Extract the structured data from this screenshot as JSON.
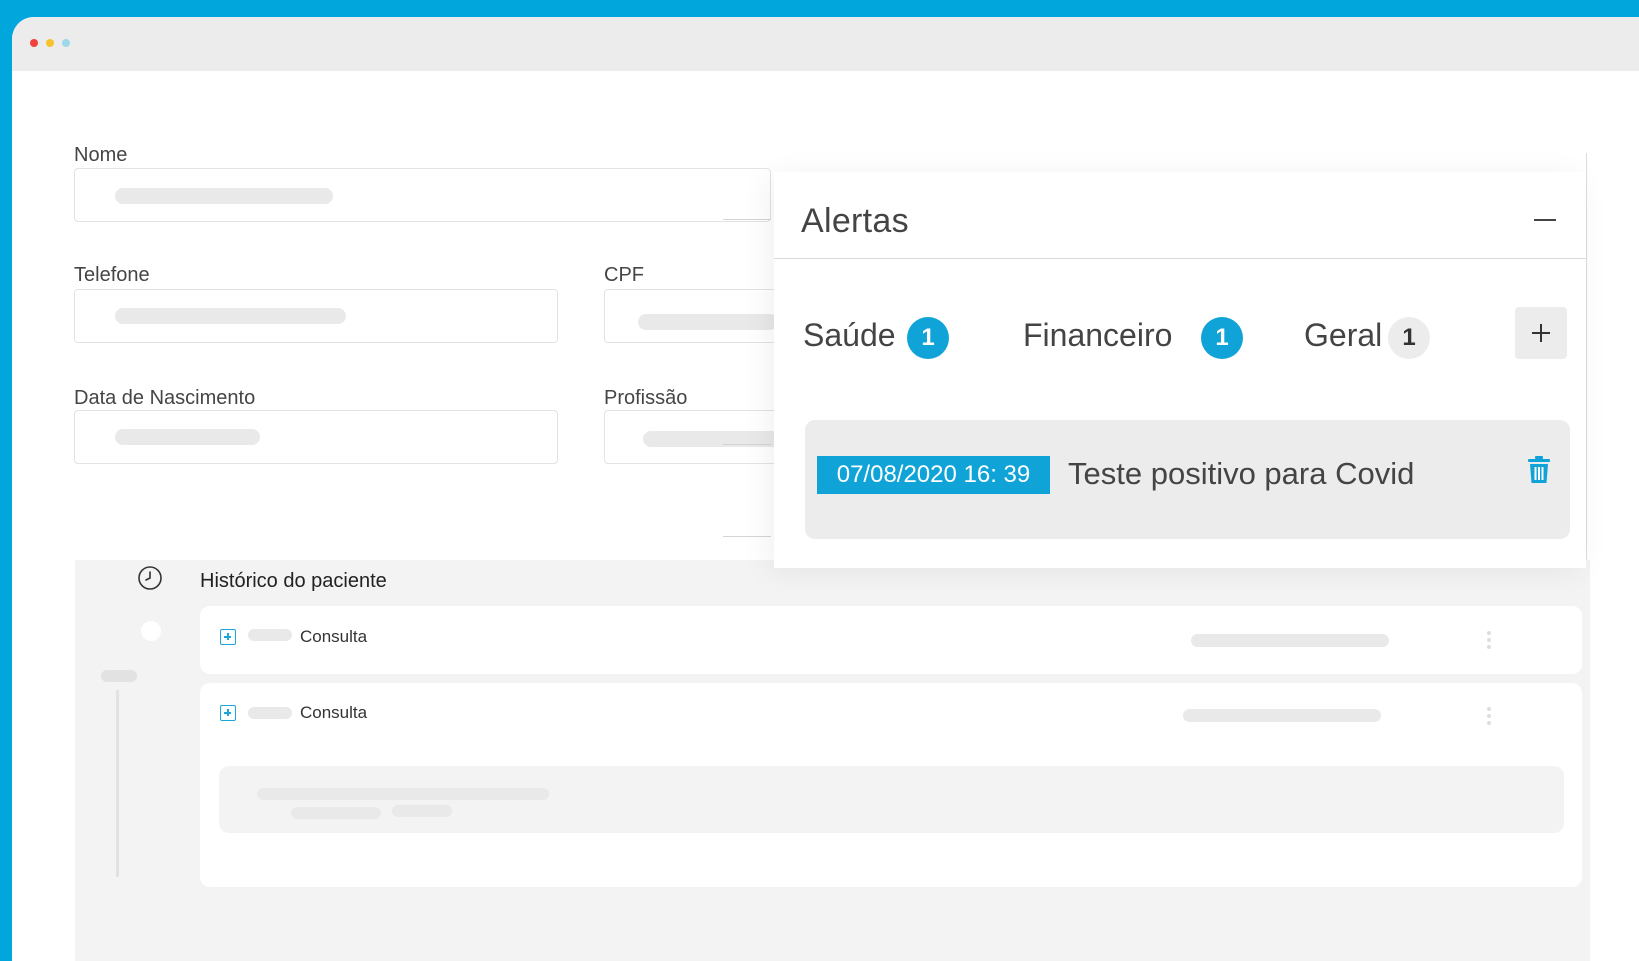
{
  "form": {
    "nome_label": "Nome",
    "telefone_label": "Telefone",
    "cpf_label": "CPF",
    "nascimento_label": "Data de Nascimento",
    "profissao_label": "Profissão"
  },
  "history": {
    "title": "Histórico do paciente",
    "cards": [
      {
        "label": "Consulta"
      },
      {
        "label": "Consulta"
      }
    ]
  },
  "alerts": {
    "title": "Alertas",
    "tabs": [
      {
        "label": "Saúde",
        "count": "1"
      },
      {
        "label": "Financeiro",
        "count": "1"
      },
      {
        "label": "Geral",
        "count": "1"
      }
    ],
    "items": [
      {
        "date": "07/08/2020 16: 39",
        "text": "Teste positivo para Covid"
      }
    ]
  },
  "colors": {
    "accent": "#0fa3d8",
    "frame": "#00a6dc"
  },
  "icons": {
    "history": "clock-icon",
    "expand": "plus-square-icon",
    "delete": "trash-icon",
    "collapse": "minus-icon",
    "add": "plus-icon",
    "menu": "kebab-icon"
  }
}
